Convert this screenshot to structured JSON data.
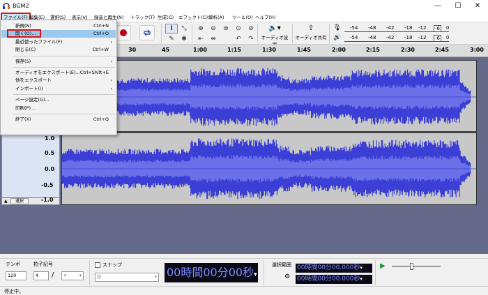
{
  "window": {
    "title": "BGM2",
    "minimize": "—",
    "maximize": "☐",
    "close": "✕"
  },
  "menubar": [
    {
      "label": "ファイル(F)"
    },
    {
      "label": "編集(E)"
    },
    {
      "label": "選択(S)"
    },
    {
      "label": "表示(V)"
    },
    {
      "label": "録音と再生(N)"
    },
    {
      "label": "トラック(T)"
    },
    {
      "label": "生成(G)"
    },
    {
      "label": "エフェクト(C)"
    },
    {
      "label": "解析(A)"
    },
    {
      "label": "ツール(O)"
    },
    {
      "label": "ヘルプ(H)"
    }
  ],
  "toolbar": {
    "audio_setup": "オーディオ設定",
    "share_audio": "オーディオ共有"
  },
  "meters": {
    "ticks": [
      "-54",
      "-48",
      "-42",
      "-18",
      "-12",
      "-6",
      "0"
    ]
  },
  "ruler": {
    "ticks": [
      "30",
      "45",
      "1:00",
      "1:15",
      "1:30",
      "1:45",
      "2:00",
      "2:15",
      "2:30",
      "2:45",
      "3:00"
    ]
  },
  "track": {
    "select_label": "選択",
    "scale": [
      "1.0",
      "0.5",
      "0.0",
      "-0.5",
      "-1.0"
    ]
  },
  "file_menu": {
    "items": [
      {
        "label": "新規(N)",
        "shortcut": "Ctrl+N",
        "submenu": false
      },
      {
        "label": "開く(O)...",
        "shortcut": "Ctrl+O",
        "submenu": false,
        "highlighted": true
      },
      {
        "label": "最近使ったファイル(F)",
        "shortcut": "",
        "submenu": true
      },
      {
        "label": "閉じる(C)",
        "shortcut": "Ctrl+W",
        "submenu": false
      },
      {
        "sep": true
      },
      {
        "label": "保存(S)",
        "shortcut": "",
        "submenu": true
      },
      {
        "sep": true
      },
      {
        "label": "オーディオをエクスポート(E)...",
        "shortcut": "Ctrl+Shift+E",
        "submenu": false
      },
      {
        "label": "他をエクスポート",
        "shortcut": "",
        "submenu": true
      },
      {
        "label": "インポート(I)",
        "shortcut": "",
        "submenu": true
      },
      {
        "sep": true
      },
      {
        "label": "ページ設定(G)...",
        "shortcut": "",
        "submenu": false
      },
      {
        "label": "印刷(P)...",
        "shortcut": "",
        "submenu": false
      },
      {
        "sep": true
      },
      {
        "label": "終了(X)",
        "shortcut": "Ctrl+Q",
        "submenu": false
      }
    ]
  },
  "bottom": {
    "tempo_label": "テンポ",
    "tempo_value": "120",
    "timesig_label": "拍子記号",
    "timesig_num": "4",
    "timesig_slash": "/",
    "timesig_den": "4",
    "snap_label": "スナップ",
    "snap_unit": "秒",
    "time_display": "00時間00分00秒",
    "selection_label": "選択範囲",
    "sel_start": "00時間00分00.000秒",
    "sel_end": "00時間00分00.000秒"
  },
  "status": {
    "text": "停止中。"
  },
  "colors": {
    "wave": "#3b3fd6",
    "wave_light": "#6b70e8",
    "highlight": "#99c9ef",
    "red_marker": "#e01010"
  }
}
